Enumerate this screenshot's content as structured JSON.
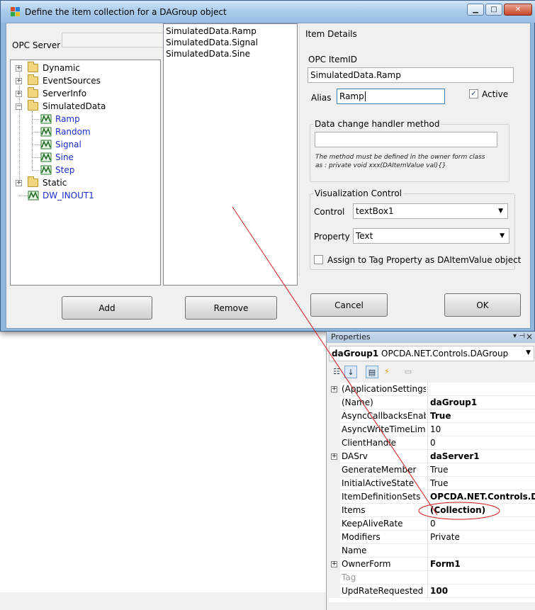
{
  "dialog": {
    "title": "Define the item collection for a DAGroup object",
    "opc_server_label": "OPC Server",
    "tree": [
      {
        "label": "Dynamic",
        "type": "folder",
        "expanded": false
      },
      {
        "label": "EventSources",
        "type": "folder",
        "expanded": false
      },
      {
        "label": "ServerInfo",
        "type": "folder",
        "expanded": false
      },
      {
        "label": "SimulatedData",
        "type": "folder",
        "expanded": true
      },
      {
        "label": "Ramp",
        "type": "item"
      },
      {
        "label": "Random",
        "type": "item"
      },
      {
        "label": "Signal",
        "type": "item"
      },
      {
        "label": "Sine",
        "type": "item"
      },
      {
        "label": "Step",
        "type": "item"
      },
      {
        "label": "Static",
        "type": "folder",
        "expanded": false
      },
      {
        "label": "DW_INOUT1",
        "type": "item"
      }
    ],
    "items": [
      "SimulatedData.Ramp",
      "SimulatedData.Signal",
      "SimulatedData.Sine"
    ],
    "details": {
      "group_title": "Item Details",
      "itemid_label": "OPC ItemID",
      "itemid_value": "SimulatedData.Ramp",
      "alias_label": "Alias",
      "alias_value": "Ramp",
      "active_label": "Active",
      "active_checked": true,
      "handler_group_title": "Data change handler method",
      "handler_value": "",
      "handler_note_1": "The method must be defined in the owner form class",
      "handler_note_2": "as : private void xxx(DAItemValue val){}",
      "viz_group_title": "Visualization Control",
      "control_label": "Control",
      "control_value": "textBox1",
      "property_label": "Property",
      "property_value": "Text",
      "assign_label": "Assign to Tag Property as DAItemValue object",
      "assign_checked": false
    },
    "buttons": {
      "add": "Add",
      "remove": "Remove",
      "cancel": "Cancel",
      "ok": "OK"
    }
  },
  "properties": {
    "header": "Properties",
    "object_name": "daGroup1",
    "object_type": "OPCDA.NET.Controls.DAGroup",
    "rows": [
      {
        "name": "(ApplicationSettings)",
        "value": "",
        "expandable": true,
        "bold": false
      },
      {
        "name": "(Name)",
        "value": "daGroup1",
        "expandable": false,
        "bold": true
      },
      {
        "name": "AsyncCallbacksEnabled",
        "value": "True",
        "expandable": false,
        "bold": true
      },
      {
        "name": "AsyncWriteTimeLimit",
        "value": "10",
        "expandable": false,
        "bold": false
      },
      {
        "name": "ClientHandle",
        "value": "0",
        "expandable": false,
        "bold": false
      },
      {
        "name": "DASrv",
        "value": "daServer1",
        "expandable": true,
        "bold": true
      },
      {
        "name": "GenerateMember",
        "value": "True",
        "expandable": false,
        "bold": false
      },
      {
        "name": "InitialActiveState",
        "value": "True",
        "expandable": false,
        "bold": false
      },
      {
        "name": "ItemDefinitionSets",
        "value": "OPCDA.NET.Controls.DAIte",
        "expandable": false,
        "bold": true
      },
      {
        "name": "Items",
        "value": "(Collection)",
        "expandable": false,
        "bold": true
      },
      {
        "name": "KeepAliveRate",
        "value": "0",
        "expandable": false,
        "bold": false
      },
      {
        "name": "Modifiers",
        "value": "Private",
        "expandable": false,
        "bold": false
      },
      {
        "name": "Name",
        "value": "",
        "expandable": false,
        "bold": false
      },
      {
        "name": "OwnerForm",
        "value": "Form1",
        "expandable": true,
        "bold": true
      },
      {
        "name": "Tag",
        "value": "",
        "expandable": false,
        "bold": false,
        "grey": true
      },
      {
        "name": "UpdRateRequested",
        "value": "100",
        "expandable": false,
        "bold": true
      }
    ]
  },
  "colors": {
    "annotation": "#d11a1a",
    "tree_item": "#1a2ccf"
  }
}
